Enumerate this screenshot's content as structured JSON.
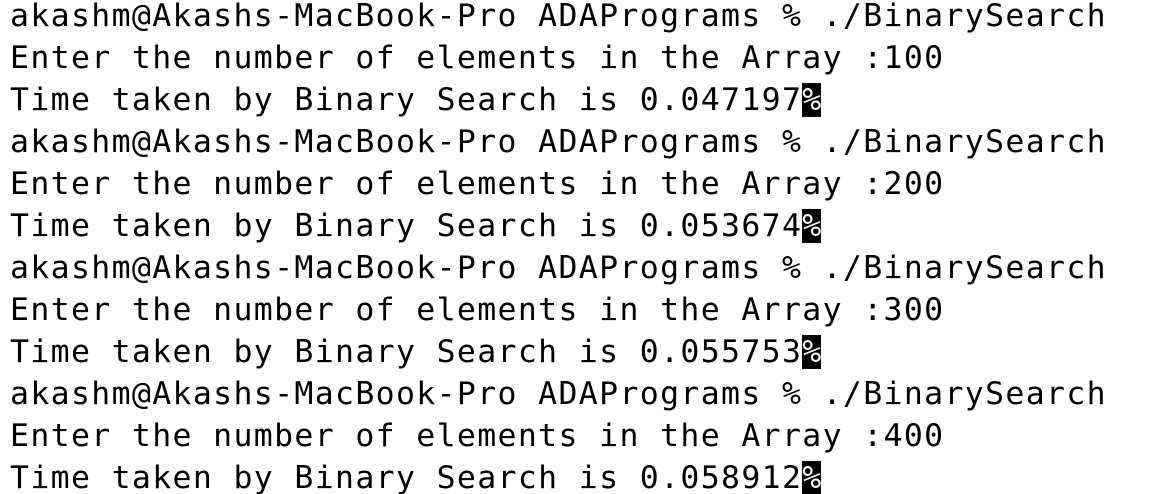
{
  "terminal": {
    "runs": [
      {
        "prompt": "akashm@Akashs-MacBook-Pro ADAPrograms % ./BinarySearch",
        "input_line": "Enter the number of elements in the Array :100",
        "output_line": "Time taken by Binary Search is 0.047197",
        "eol_mark": "%"
      },
      {
        "prompt": "akashm@Akashs-MacBook-Pro ADAPrograms % ./BinarySearch",
        "input_line": "Enter the number of elements in the Array :200",
        "output_line": "Time taken by Binary Search is 0.053674",
        "eol_mark": "%"
      },
      {
        "prompt": "akashm@Akashs-MacBook-Pro ADAPrograms % ./BinarySearch",
        "input_line": "Enter the number of elements in the Array :300",
        "output_line": "Time taken by Binary Search is 0.055753",
        "eol_mark": "%"
      },
      {
        "prompt": "akashm@Akashs-MacBook-Pro ADAPrograms % ./BinarySearch",
        "input_line": "Enter the number of elements in the Array :400",
        "output_line": "Time taken by Binary Search is 0.058912",
        "eol_mark": "%"
      }
    ]
  }
}
